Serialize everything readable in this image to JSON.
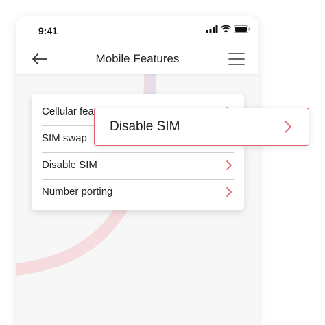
{
  "status_bar": {
    "time": "9:41",
    "icons": [
      "signal-icon",
      "wifi-icon",
      "battery-icon"
    ]
  },
  "nav": {
    "title": "Mobile Features",
    "back_icon": "arrow-left-icon",
    "menu_icon": "hamburger-menu-icon"
  },
  "menu": {
    "items": [
      {
        "label": "Cellular features"
      },
      {
        "label": "SIM swap"
      },
      {
        "label": "Disable SIM"
      },
      {
        "label": "Number porting"
      }
    ]
  },
  "callout": {
    "label": "Disable SIM"
  },
  "colors": {
    "accent": "#e0606a",
    "arc": "#f7c9ce",
    "text": "#222222"
  }
}
